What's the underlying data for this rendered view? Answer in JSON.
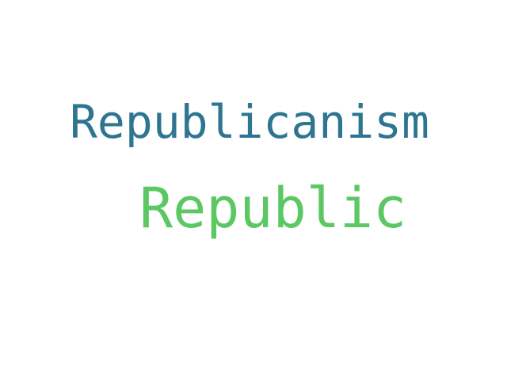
{
  "word_cloud": {
    "words": [
      {
        "text": "Republicanism",
        "color": "#2e7591"
      },
      {
        "text": "Republic",
        "color": "#5cc863"
      }
    ]
  }
}
